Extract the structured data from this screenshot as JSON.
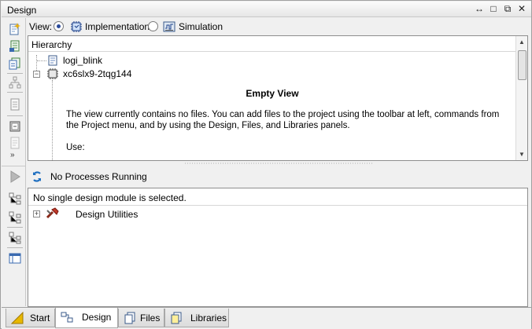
{
  "window": {
    "title": "Design",
    "buttons": [
      "↔",
      "□",
      "⧉",
      "✕"
    ]
  },
  "viewbar": {
    "label": "View:",
    "options": [
      {
        "label": "Implementation",
        "selected": true
      },
      {
        "label": "Simulation",
        "selected": false
      }
    ]
  },
  "hierarchy": {
    "header": "Hierarchy",
    "items": [
      {
        "label": "logi_blink",
        "icon": "verilog-file-icon"
      },
      {
        "label": "xc6slx9-2tqg144",
        "icon": "device-chip-icon",
        "expanded": true
      }
    ],
    "empty_view": {
      "title": "Empty View",
      "text": "The view currently contains no files. You can add files to the project using the toolbar at left, commands from the Project menu, and by using the Design, Files, and Libraries panels.",
      "use_label": "Use:"
    }
  },
  "processes": {
    "status": "No Processes Running",
    "header": "No single design module is selected.",
    "items": [
      {
        "label": "Design Utilities",
        "icon": "tools-icon",
        "expanded": false
      }
    ]
  },
  "tabs": [
    {
      "label": "Start",
      "icon": "start-icon",
      "active": false
    },
    {
      "label": "Design",
      "icon": "design-icon",
      "active": true
    },
    {
      "label": "Files",
      "icon": "files-icon",
      "active": false
    },
    {
      "label": "Libraries",
      "icon": "libraries-icon",
      "active": false
    }
  ]
}
